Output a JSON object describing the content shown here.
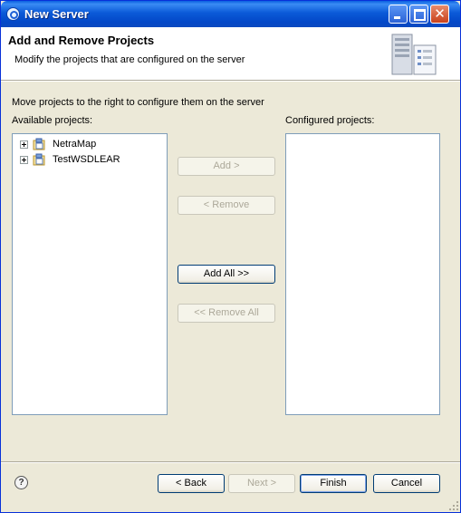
{
  "window": {
    "title": "New Server"
  },
  "banner": {
    "title": "Add and Remove Projects",
    "description": "Modify the projects that are configured on the server"
  },
  "instruction": "Move projects to the right to configure them on the server",
  "available": {
    "label": "Available projects:",
    "items": [
      {
        "label": "NetraMap",
        "icon": "project-folder-icon",
        "expanded": false
      },
      {
        "label": "TestWSDLEAR",
        "icon": "project-folder-icon",
        "expanded": false
      }
    ]
  },
  "configured": {
    "label": "Configured projects:",
    "items": []
  },
  "buttons": {
    "add": {
      "label": "Add >",
      "enabled": false
    },
    "remove": {
      "label": "< Remove",
      "enabled": false
    },
    "add_all": {
      "label": "Add All >>",
      "enabled": true
    },
    "remove_all": {
      "label": "<< Remove All",
      "enabled": false
    }
  },
  "footer": {
    "help_icon": "question-mark",
    "back": "< Back",
    "next": "Next >",
    "finish": "Finish",
    "cancel": "Cancel"
  },
  "colors": {
    "titlebar": "#0a5fe0",
    "dialog_bg": "#ece9d8",
    "list_border": "#7f9db9"
  }
}
